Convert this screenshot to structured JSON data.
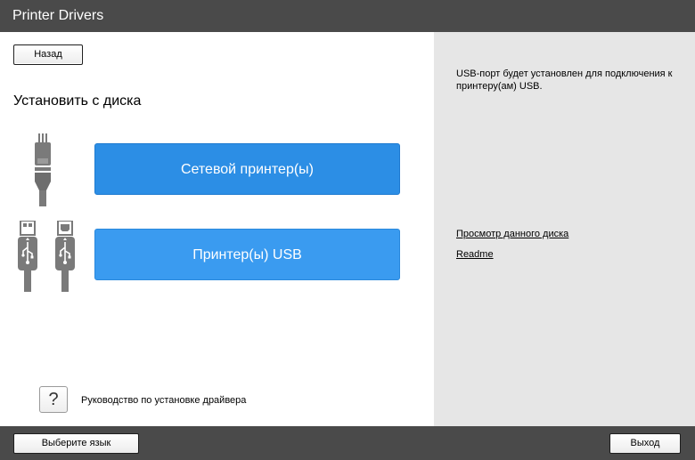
{
  "window": {
    "title": "Printer Drivers"
  },
  "left": {
    "back_label": "Назад",
    "section_title": "Установить с диска",
    "network_button": "Сетевой принтер(ы)",
    "usb_button": "Принтер(ы) USB",
    "help_glyph": "?",
    "help_label": "Руководство по установке драйвера"
  },
  "right": {
    "info_text": "USB-порт будет установлен для подключения к принтеру(ам) USB.",
    "links": {
      "view_disk": "Просмотр данного диска",
      "readme": "Readme"
    }
  },
  "footer": {
    "language_label": "Выберите язык",
    "exit_label": "Выход"
  },
  "colors": {
    "titlebar": "#4a4a4a",
    "network_button": "#2c8ee5",
    "usb_button": "#3a9bf0",
    "right_pane": "#e6e6e6",
    "icon_gray": "#7a7a7a"
  },
  "icons": {
    "network": "network-cable-icon",
    "usb": "usb-cable-icon",
    "help": "question-icon"
  }
}
